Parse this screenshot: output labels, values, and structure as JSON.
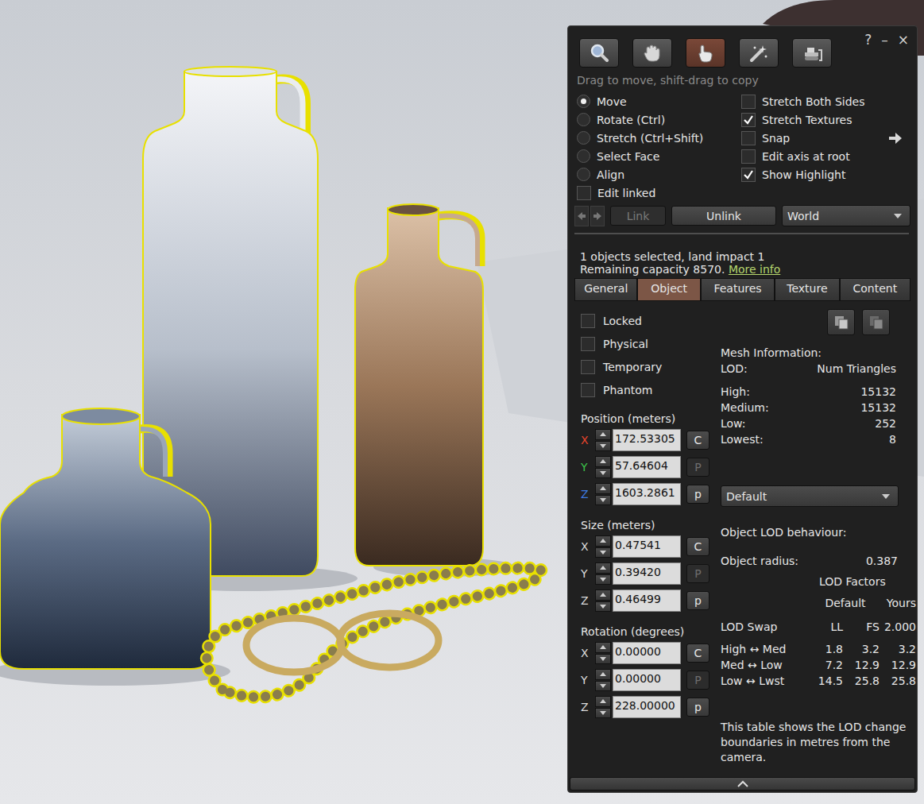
{
  "window": {
    "controls": [
      "?",
      "–",
      "×"
    ]
  },
  "tools": [
    {
      "selected": false
    },
    {
      "selected": false
    },
    {
      "selected": true
    },
    {
      "selected": false
    },
    {
      "selected": false
    }
  ],
  "hint": "Drag to move, shift-drag to copy",
  "modes": [
    {
      "label": "Move",
      "selected": true
    },
    {
      "label": "Rotate (Ctrl)",
      "selected": false
    },
    {
      "label": "Stretch (Ctrl+Shift)",
      "selected": false
    },
    {
      "label": "Select Face",
      "selected": false
    },
    {
      "label": "Align",
      "selected": false
    }
  ],
  "edit_linked": {
    "label": "Edit linked",
    "checked": false
  },
  "options": [
    {
      "label": "Stretch Both Sides",
      "checked": false
    },
    {
      "label": "Stretch Textures",
      "checked": true
    },
    {
      "label": "Snap",
      "checked": false
    },
    {
      "label": "Edit axis at root",
      "checked": false
    },
    {
      "label": "Show Highlight",
      "checked": true
    }
  ],
  "link_bar": {
    "buttons": [
      {
        "label": "Link",
        "disabled": true
      },
      {
        "label": "Unlink",
        "disabled": false
      }
    ],
    "ruler": "World"
  },
  "selection": {
    "summary": "1 objects selected, land impact 1",
    "capacity": "Remaining capacity 8570.",
    "link": "More info"
  },
  "tabs": [
    {
      "label": "General",
      "selected": false
    },
    {
      "label": "Object",
      "selected": true
    },
    {
      "label": "Features",
      "selected": false
    },
    {
      "label": "Texture",
      "selected": false
    },
    {
      "label": "Content",
      "selected": false
    }
  ],
  "flags": [
    {
      "label": "Locked",
      "checked": false
    },
    {
      "label": "Physical",
      "checked": false
    },
    {
      "label": "Temporary",
      "checked": false
    },
    {
      "label": "Phantom",
      "checked": false
    }
  ],
  "transform": [
    {
      "title": "Position (meters)",
      "fields": [
        {
          "axis": "X",
          "value": "172.53305",
          "button": "C",
          "disabled": false,
          "color": "#e8452c"
        },
        {
          "axis": "Y",
          "value": "57.64604",
          "button": "P",
          "disabled": true,
          "color": "#3cc24a"
        },
        {
          "axis": "Z",
          "value": "1603.2861",
          "button": "p",
          "disabled": false,
          "color": "#3d7be0"
        }
      ]
    },
    {
      "title": "Size (meters)",
      "fields": [
        {
          "axis": "X",
          "value": "0.47541",
          "button": "C",
          "disabled": false
        },
        {
          "axis": "Y",
          "value": "0.39420",
          "button": "P",
          "disabled": true
        },
        {
          "axis": "Z",
          "value": "0.46499",
          "button": "p",
          "disabled": false
        }
      ]
    },
    {
      "title": "Rotation (degrees)",
      "fields": [
        {
          "axis": "X",
          "value": "0.00000",
          "button": "C",
          "disabled": false
        },
        {
          "axis": "Y",
          "value": "0.00000",
          "button": "P",
          "disabled": true
        },
        {
          "axis": "Z",
          "value": "228.00000",
          "button": "p",
          "disabled": false
        }
      ]
    }
  ],
  "mesh_info": {
    "title": "Mesh Information:",
    "header": [
      "LOD:",
      "Num Triangles"
    ],
    "rows": [
      [
        "High:",
        "15132"
      ],
      [
        "Medium:",
        "15132"
      ],
      [
        "Low:",
        "252"
      ],
      [
        "Lowest:",
        "8"
      ]
    ]
  },
  "lod_mode": "Default",
  "lod_behaviour": {
    "title": "Object LOD behaviour:",
    "radius_label": "Object radius:",
    "radius": "0.387",
    "factors_title": "LOD Factors",
    "columns": [
      "Default",
      "Yours"
    ],
    "header": [
      "LOD Swap",
      "LL",
      "FS",
      "2.000"
    ],
    "rows": [
      [
        "High ↔ Med",
        "1.8",
        "3.2",
        "3.2"
      ],
      [
        "Med ↔ Low",
        "7.2",
        "12.9",
        "12.9"
      ],
      [
        "Low ↔ Lwst",
        "14.5",
        "25.8",
        "25.8"
      ]
    ],
    "note": "This table shows the LOD change boundaries in metres from the camera."
  }
}
